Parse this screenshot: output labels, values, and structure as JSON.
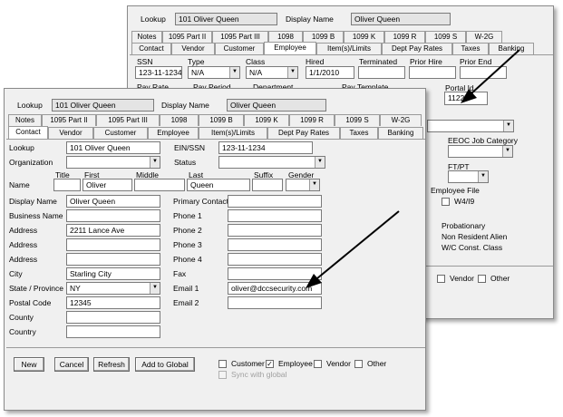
{
  "back_window": {
    "lookup_label": "Lookup",
    "lookup_value": "101 Oliver Queen",
    "display_name_label": "Display Name",
    "display_name_value": "Oliver Queen",
    "tabs_row1": [
      "Notes",
      "1095 Part II",
      "1095 Part III",
      "1098",
      "1099 B",
      "1099 K",
      "1099 R",
      "1099 S",
      "W-2G"
    ],
    "tabs_row2": [
      "Contact",
      "Vendor",
      "Customer",
      "Employee",
      "Item(s)/Limits",
      "Dept Pay Rates",
      "Taxes",
      "Banking"
    ],
    "active_tab": "Employee",
    "ssn_label": "SSN",
    "ssn_value": "123-11-1234",
    "type_label": "Type",
    "type_value": "N/A",
    "class_label": "Class",
    "class_value": "N/A",
    "hired_label": "Hired",
    "hired_value": "1/1/2010",
    "terminated_label": "Terminated",
    "prior_hire_label": "Prior Hire",
    "prior_end_label": "Prior End",
    "partial_labels": [
      "Pay Rate",
      "Pay Period",
      "Department",
      "Pay Template"
    ],
    "portal_id_label": "Portal Id",
    "portal_id_value": "11227",
    "eeoc_label": "EEOC Job Category",
    "ftpt_label": "FT/PT",
    "employee_file_label": "Employee File",
    "w4_label": "W4/I9",
    "status_items": [
      "Probationary",
      "Non Resident Alien",
      "W/C Const. Class"
    ],
    "bottom_checks": [
      "Vendor",
      "Other"
    ]
  },
  "front_window": {
    "lookup_label": "Lookup",
    "lookup_value": "101 Oliver Queen",
    "display_name_label": "Display Name",
    "display_name_value": "Oliver Queen",
    "tabs_row1": [
      "Notes",
      "1095 Part II",
      "1095 Part III",
      "1098",
      "1099 B",
      "1099 K",
      "1099 R",
      "1099 S",
      "W-2G"
    ],
    "tabs_row2": [
      "Contact",
      "Vendor",
      "Customer",
      "Employee",
      "Item(s)/Limits",
      "Dept Pay Rates",
      "Taxes",
      "Banking"
    ],
    "active_tab": "Contact",
    "form": {
      "lookup_label": "Lookup",
      "lookup_value": "101 Oliver Queen",
      "ein_label": "EIN/SSN",
      "ein_value": "123-11-1234",
      "organization_label": "Organization",
      "status_label": "Status",
      "name_label": "Name",
      "title_label": "Title",
      "first_label": "First",
      "first_value": "Oliver",
      "middle_label": "Middle",
      "last_label": "Last",
      "last_value": "Queen",
      "suffix_label": "Suffix",
      "gender_label": "Gender",
      "display_name_label": "Display Name",
      "display_name_value": "Oliver Queen",
      "business_name_label": "Business Name",
      "address1_label": "Address",
      "address1_value": "2211 Lance Ave",
      "address2_label": "Address",
      "address3_label": "Address",
      "city_label": "City",
      "city_value": "Starling City",
      "state_label": "State / Province",
      "state_value": "NY",
      "postal_label": "Postal Code",
      "postal_value": "12345",
      "county_label": "County",
      "country_label": "Country",
      "primary_contact_label": "Primary Contact",
      "phone1_label": "Phone 1",
      "phone2_label": "Phone 2",
      "phone3_label": "Phone 3",
      "phone4_label": "Phone 4",
      "fax_label": "Fax",
      "email1_label": "Email 1",
      "email1_value": "oliver@dccsecurity.com",
      "email2_label": "Email 2"
    },
    "buttons": {
      "new": "New",
      "cancel": "Cancel",
      "refresh": "Refresh",
      "add_to_global": "Add to Global"
    },
    "checks": {
      "customer": "Customer",
      "employee": "Employee",
      "vendor": "Vendor",
      "other": "Other",
      "sync": "Sync with global"
    }
  }
}
